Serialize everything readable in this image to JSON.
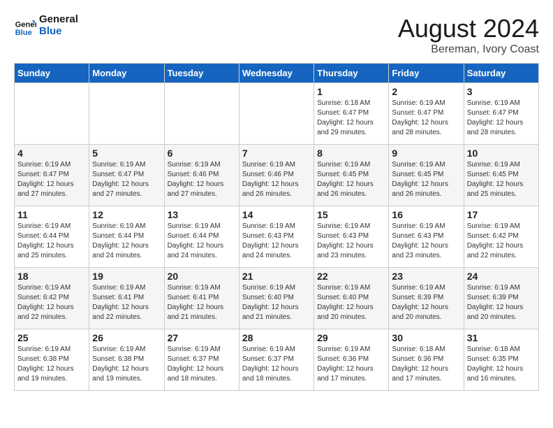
{
  "header": {
    "logo_line1": "General",
    "logo_line2": "Blue",
    "month_title": "August 2024",
    "location": "Bereman, Ivory Coast"
  },
  "days_of_week": [
    "Sunday",
    "Monday",
    "Tuesday",
    "Wednesday",
    "Thursday",
    "Friday",
    "Saturday"
  ],
  "weeks": [
    [
      {
        "day": "",
        "info": ""
      },
      {
        "day": "",
        "info": ""
      },
      {
        "day": "",
        "info": ""
      },
      {
        "day": "",
        "info": ""
      },
      {
        "day": "1",
        "info": "Sunrise: 6:18 AM\nSunset: 6:47 PM\nDaylight: 12 hours\nand 29 minutes."
      },
      {
        "day": "2",
        "info": "Sunrise: 6:19 AM\nSunset: 6:47 PM\nDaylight: 12 hours\nand 28 minutes."
      },
      {
        "day": "3",
        "info": "Sunrise: 6:19 AM\nSunset: 6:47 PM\nDaylight: 12 hours\nand 28 minutes."
      }
    ],
    [
      {
        "day": "4",
        "info": "Sunrise: 6:19 AM\nSunset: 6:47 PM\nDaylight: 12 hours\nand 27 minutes."
      },
      {
        "day": "5",
        "info": "Sunrise: 6:19 AM\nSunset: 6:47 PM\nDaylight: 12 hours\nand 27 minutes."
      },
      {
        "day": "6",
        "info": "Sunrise: 6:19 AM\nSunset: 6:46 PM\nDaylight: 12 hours\nand 27 minutes."
      },
      {
        "day": "7",
        "info": "Sunrise: 6:19 AM\nSunset: 6:46 PM\nDaylight: 12 hours\nand 26 minutes."
      },
      {
        "day": "8",
        "info": "Sunrise: 6:19 AM\nSunset: 6:45 PM\nDaylight: 12 hours\nand 26 minutes."
      },
      {
        "day": "9",
        "info": "Sunrise: 6:19 AM\nSunset: 6:45 PM\nDaylight: 12 hours\nand 26 minutes."
      },
      {
        "day": "10",
        "info": "Sunrise: 6:19 AM\nSunset: 6:45 PM\nDaylight: 12 hours\nand 25 minutes."
      }
    ],
    [
      {
        "day": "11",
        "info": "Sunrise: 6:19 AM\nSunset: 6:44 PM\nDaylight: 12 hours\nand 25 minutes."
      },
      {
        "day": "12",
        "info": "Sunrise: 6:19 AM\nSunset: 6:44 PM\nDaylight: 12 hours\nand 24 minutes."
      },
      {
        "day": "13",
        "info": "Sunrise: 6:19 AM\nSunset: 6:44 PM\nDaylight: 12 hours\nand 24 minutes."
      },
      {
        "day": "14",
        "info": "Sunrise: 6:19 AM\nSunset: 6:43 PM\nDaylight: 12 hours\nand 24 minutes."
      },
      {
        "day": "15",
        "info": "Sunrise: 6:19 AM\nSunset: 6:43 PM\nDaylight: 12 hours\nand 23 minutes."
      },
      {
        "day": "16",
        "info": "Sunrise: 6:19 AM\nSunset: 6:43 PM\nDaylight: 12 hours\nand 23 minutes."
      },
      {
        "day": "17",
        "info": "Sunrise: 6:19 AM\nSunset: 6:42 PM\nDaylight: 12 hours\nand 22 minutes."
      }
    ],
    [
      {
        "day": "18",
        "info": "Sunrise: 6:19 AM\nSunset: 6:42 PM\nDaylight: 12 hours\nand 22 minutes."
      },
      {
        "day": "19",
        "info": "Sunrise: 6:19 AM\nSunset: 6:41 PM\nDaylight: 12 hours\nand 22 minutes."
      },
      {
        "day": "20",
        "info": "Sunrise: 6:19 AM\nSunset: 6:41 PM\nDaylight: 12 hours\nand 21 minutes."
      },
      {
        "day": "21",
        "info": "Sunrise: 6:19 AM\nSunset: 6:40 PM\nDaylight: 12 hours\nand 21 minutes."
      },
      {
        "day": "22",
        "info": "Sunrise: 6:19 AM\nSunset: 6:40 PM\nDaylight: 12 hours\nand 20 minutes."
      },
      {
        "day": "23",
        "info": "Sunrise: 6:19 AM\nSunset: 6:39 PM\nDaylight: 12 hours\nand 20 minutes."
      },
      {
        "day": "24",
        "info": "Sunrise: 6:19 AM\nSunset: 6:39 PM\nDaylight: 12 hours\nand 20 minutes."
      }
    ],
    [
      {
        "day": "25",
        "info": "Sunrise: 6:19 AM\nSunset: 6:38 PM\nDaylight: 12 hours\nand 19 minutes."
      },
      {
        "day": "26",
        "info": "Sunrise: 6:19 AM\nSunset: 6:38 PM\nDaylight: 12 hours\nand 19 minutes."
      },
      {
        "day": "27",
        "info": "Sunrise: 6:19 AM\nSunset: 6:37 PM\nDaylight: 12 hours\nand 18 minutes."
      },
      {
        "day": "28",
        "info": "Sunrise: 6:19 AM\nSunset: 6:37 PM\nDaylight: 12 hours\nand 18 minutes."
      },
      {
        "day": "29",
        "info": "Sunrise: 6:19 AM\nSunset: 6:36 PM\nDaylight: 12 hours\nand 17 minutes."
      },
      {
        "day": "30",
        "info": "Sunrise: 6:18 AM\nSunset: 6:36 PM\nDaylight: 12 hours\nand 17 minutes."
      },
      {
        "day": "31",
        "info": "Sunrise: 6:18 AM\nSunset: 6:35 PM\nDaylight: 12 hours\nand 16 minutes."
      }
    ]
  ]
}
